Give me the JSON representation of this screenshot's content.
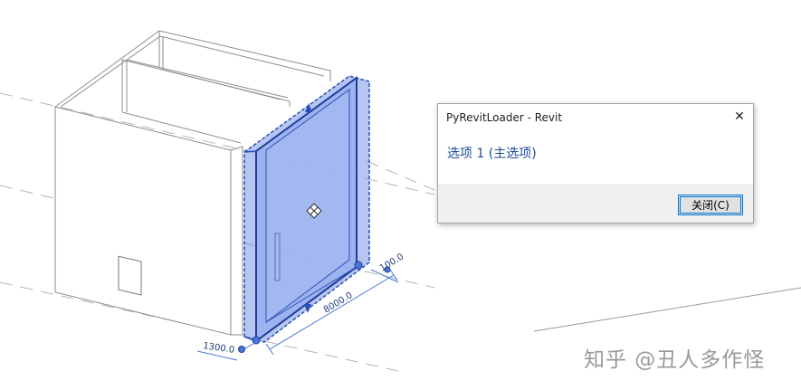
{
  "dialog": {
    "title": "PyRevitLoader - Revit",
    "message": "选项 1 (主选项)",
    "close_button_label": "关闭(C)"
  },
  "model": {
    "dimension_width": "8000.0",
    "dimension_depth": "1300.0",
    "dimension_small": "100.0"
  },
  "watermark": "知乎 @丑人多作怪",
  "colors": {
    "selection_fill": "#7a98e6",
    "selection_edge": "#2b4fb8",
    "dimension_color": "#4a78d8",
    "message_color": "#1a4e95"
  }
}
